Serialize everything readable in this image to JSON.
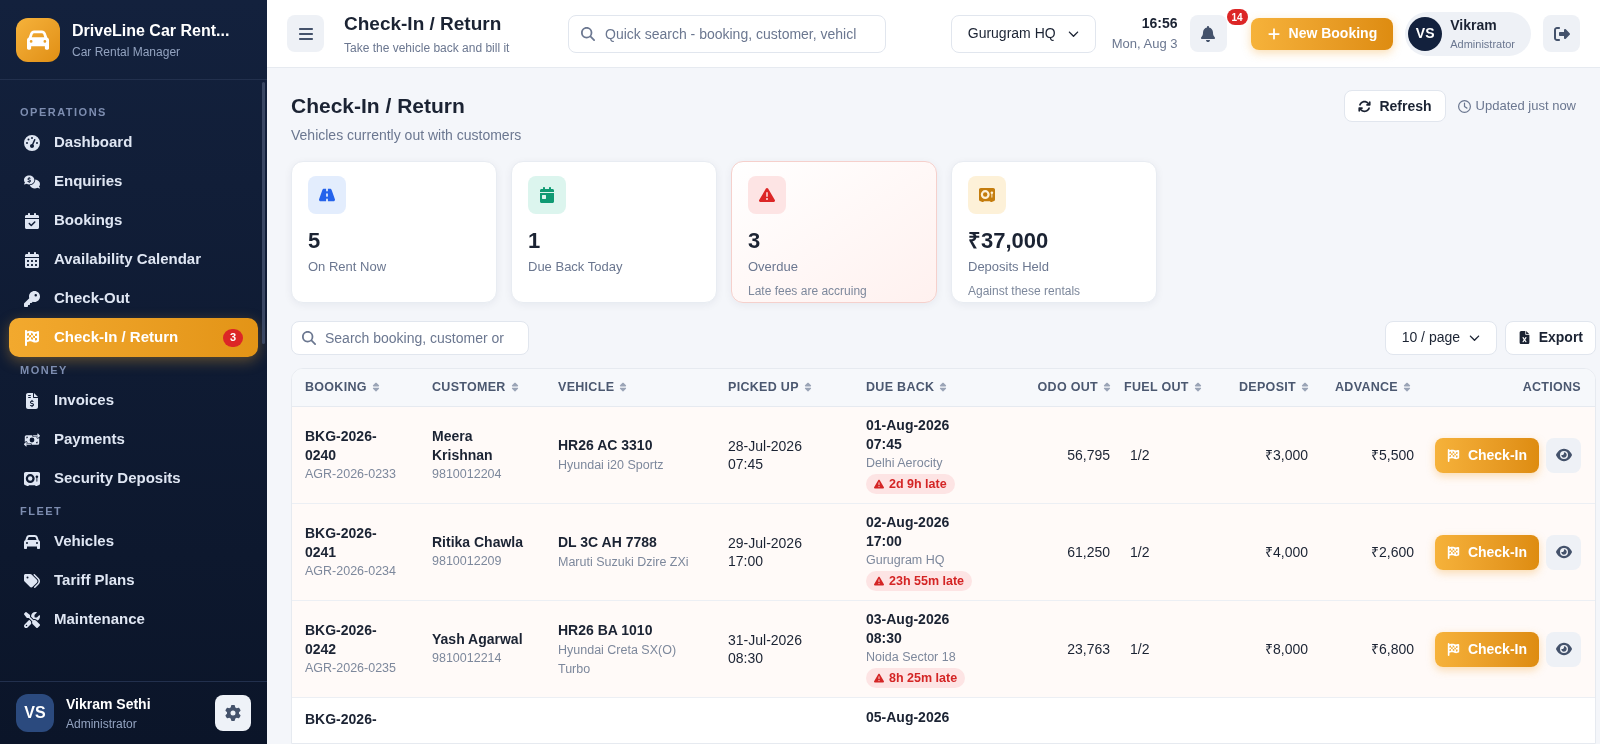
{
  "sidebar": {
    "brand": {
      "name": "DriveLine Car Rent...",
      "tagline": "Car Rental Manager"
    },
    "sections": [
      {
        "title": "OPERATIONS",
        "items": [
          {
            "label": "Dashboard",
            "selected": false
          },
          {
            "label": "Enquiries",
            "selected": false
          },
          {
            "label": "Bookings",
            "selected": false
          },
          {
            "label": "Availability Calendar",
            "selected": false
          },
          {
            "label": "Check-Out",
            "selected": false
          },
          {
            "label": "Check-In / Return",
            "selected": true,
            "badge": "3"
          }
        ]
      },
      {
        "title": "MONEY",
        "items": [
          {
            "label": "Invoices",
            "selected": false
          },
          {
            "label": "Payments",
            "selected": false
          },
          {
            "label": "Security Deposits",
            "selected": false
          }
        ]
      },
      {
        "title": "FLEET",
        "items": [
          {
            "label": "Vehicles",
            "selected": false
          },
          {
            "label": "Tariff Plans",
            "selected": false
          },
          {
            "label": "Maintenance",
            "selected": false
          }
        ]
      }
    ],
    "user": {
      "initials": "VS",
      "name": "Vikram Sethi",
      "role": "Administrator"
    }
  },
  "header": {
    "title": "Check-In / Return",
    "subtitle": "Take the vehicle back and bill it",
    "search": {
      "placeholder": "Quick search - booking, customer, vehicl"
    },
    "branch": "Gurugram HQ",
    "time": "16:56",
    "date": "Mon, Aug 3",
    "notifications": "14",
    "new_booking": "New Booking",
    "user": {
      "initials": "VS",
      "name": "Vikram",
      "role": "Administrator"
    }
  },
  "page": {
    "title": "Check-In / Return",
    "subtitle": "Vehicles currently out with customers",
    "refresh": "Refresh",
    "updated": "Updated just now"
  },
  "stats": [
    {
      "kind": "info",
      "value": "5",
      "label": "On Rent Now"
    },
    {
      "kind": "success",
      "value": "1",
      "label": "Due Back Today"
    },
    {
      "kind": "danger",
      "value": "3",
      "label": "Overdue",
      "note": "Late fees are accruing"
    },
    {
      "kind": "warning",
      "value": "₹37,000",
      "label": "Deposits Held",
      "note": "Against these rentals"
    }
  ],
  "toolbar": {
    "search": {
      "placeholder": "Search booking, customer or"
    },
    "page_size": "10 / page",
    "export": "Export"
  },
  "table": {
    "columns": [
      {
        "label": "BOOKING",
        "sortable": true
      },
      {
        "label": "CUSTOMER",
        "sortable": true
      },
      {
        "label": "VEHICLE",
        "sortable": true
      },
      {
        "label": "PICKED UP",
        "sortable": true
      },
      {
        "label": "DUE BACK",
        "sortable": true
      },
      {
        "label": "ODO OUT",
        "sortable": true
      },
      {
        "label": "FUEL OUT",
        "sortable": true
      },
      {
        "label": "DEPOSIT",
        "sortable": true
      },
      {
        "label": "ADVANCE",
        "sortable": true
      },
      {
        "label": "ACTIONS",
        "sortable": false
      }
    ],
    "rows": [
      {
        "overdue": true,
        "booking": "BKG-2026-0240",
        "agreement": "AGR-2026-0233",
        "customer": "Meera Krishnan",
        "phone": "9810012204",
        "plate": "HR26 AC 3310",
        "model": "Hyundai i20 Sportz",
        "picked_up": "28-Jul-2026 07:45",
        "due_back": "01-Aug-2026 07:45",
        "location": "Delhi Aerocity",
        "late": "2d 9h late",
        "odo": "56,795",
        "fuel": "1/2",
        "deposit": "₹3,000",
        "advance": "₹5,500",
        "action": "Check-In"
      },
      {
        "overdue": true,
        "booking": "BKG-2026-0241",
        "agreement": "AGR-2026-0234",
        "customer": "Ritika Chawla",
        "phone": "9810012209",
        "plate": "DL 3C AH 7788",
        "model": "Maruti Suzuki Dzire ZXi",
        "picked_up": "29-Jul-2026 17:00",
        "due_back": "02-Aug-2026 17:00",
        "location": "Gurugram HQ",
        "late": "23h 55m late",
        "odo": "61,250",
        "fuel": "1/2",
        "deposit": "₹4,000",
        "advance": "₹2,600",
        "action": "Check-In"
      },
      {
        "overdue": true,
        "booking": "BKG-2026-0242",
        "agreement": "AGR-2026-0235",
        "customer": "Yash Agarwal",
        "phone": "9810012214",
        "plate": "HR26 BA 1010",
        "model": "Hyundai Creta SX(O) Turbo",
        "picked_up": "31-Jul-2026 08:30",
        "due_back": "03-Aug-2026 08:30",
        "location": "Noida Sector 18",
        "late": "8h 25m late",
        "odo": "23,763",
        "fuel": "1/2",
        "deposit": "₹8,000",
        "advance": "₹6,800",
        "action": "Check-In"
      },
      {
        "booking": "BKG-2026-",
        "due_back": "05-Aug-2026"
      }
    ]
  }
}
